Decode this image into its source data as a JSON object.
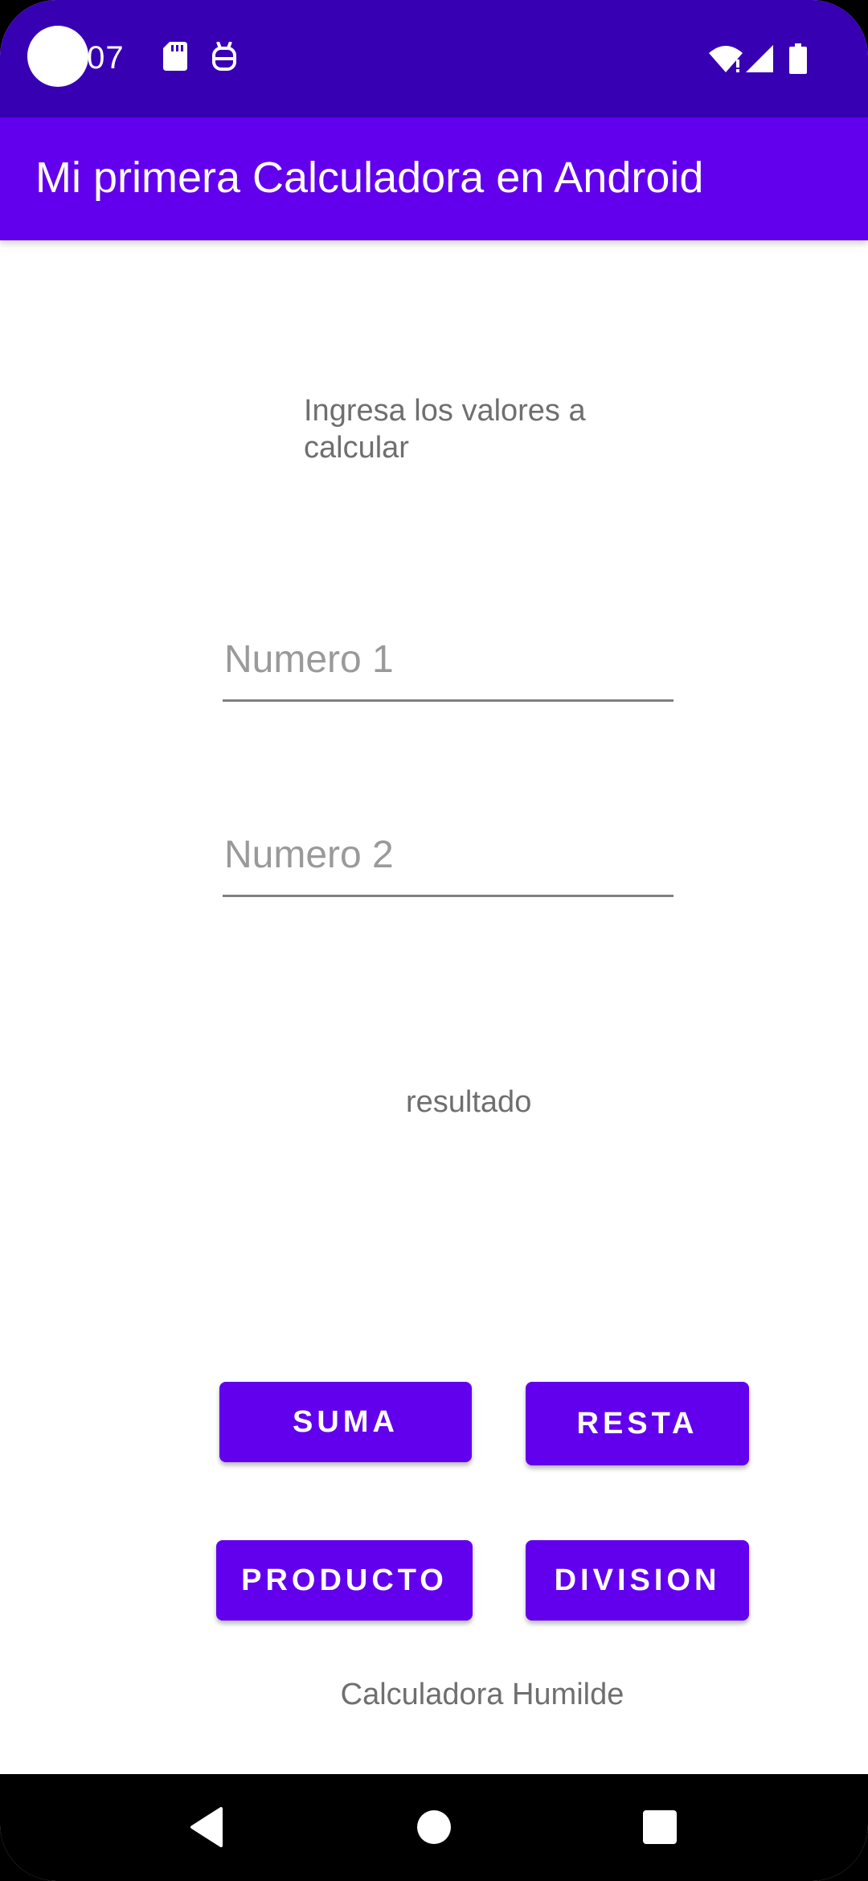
{
  "status_bar": {
    "time": ":07",
    "icons": [
      "camera-hole",
      "sd-card-icon",
      "notification-icon",
      "wifi-icon",
      "signal-icon",
      "battery-icon"
    ]
  },
  "app_bar": {
    "title": "Mi primera Calculadora en Android"
  },
  "main": {
    "instruction": "Ingresa los valores a calcular",
    "number1_placeholder": "Numero 1",
    "number2_placeholder": "Numero 2",
    "result_text": "resultado",
    "buttons": {
      "suma": "SUMA",
      "resta": "RESTA",
      "producto": "PRODUCTO",
      "division": "DIVISION"
    },
    "footer": "Calculadora Humilde"
  },
  "nav_bar": {
    "icons": [
      "back-icon",
      "home-icon",
      "recents-icon"
    ]
  },
  "colors": {
    "status_bar": "#3700b3",
    "app_bar": "#6200ee",
    "button": "#6200ee",
    "text_secondary": "#6f6f6f"
  }
}
